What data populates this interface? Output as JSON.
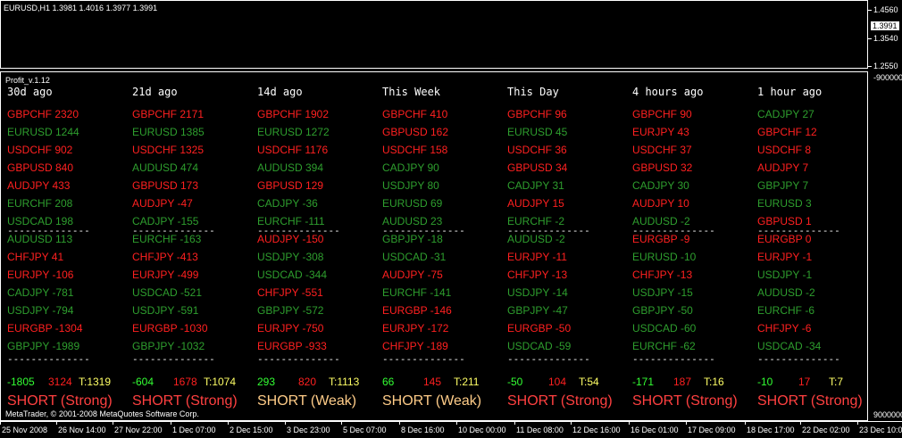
{
  "top_chart": {
    "title": "EURUSD,H1  1.3981 1.4016 1.3977 1.3991",
    "axis_labels": [
      "1.4560",
      "1.3540",
      "1.2550"
    ],
    "current_price": "1.3991"
  },
  "indicator": {
    "title": "Profit_v.1.12",
    "axis_labels": [
      "9000000",
      "-9000000"
    ],
    "copyright": "MetaTrader, © 2001-2008 MetaQuotes Software Corp.",
    "separator": "--------------",
    "colors": {
      "red": "#ff2020",
      "green": "#2e9e2e",
      "lime": "#33ff33",
      "yellow": "#ffff66",
      "peach": "#ffcc88"
    },
    "columns": [
      {
        "header": "30d ago",
        "top": [
          [
            "GBPCHF 2320",
            "red"
          ],
          [
            "EURUSD 1244",
            "green"
          ],
          [
            "USDCHF 902",
            "red"
          ],
          [
            "GBPUSD 840",
            "red"
          ],
          [
            "AUDJPY 433",
            "red"
          ],
          [
            "EURCHF 208",
            "green"
          ],
          [
            "USDCAD 198",
            "green"
          ]
        ],
        "bottom": [
          [
            "AUDUSD 113",
            "green"
          ],
          [
            "CHFJPY 41",
            "red"
          ],
          [
            "EURJPY -106",
            "red"
          ],
          [
            "CADJPY -781",
            "green"
          ],
          [
            "USDJPY -794",
            "green"
          ],
          [
            "EURGBP -1304",
            "red"
          ],
          [
            "GBPJPY -1989",
            "green"
          ]
        ],
        "totals": {
          "a": "-1805",
          "b": "3124",
          "t": "T:1319"
        },
        "signal": "SHORT (Strong)",
        "signal_color": "orange"
      },
      {
        "header": "21d ago",
        "top": [
          [
            "GBPCHF 2171",
            "red"
          ],
          [
            "EURUSD 1385",
            "green"
          ],
          [
            "USDCHF 1325",
            "red"
          ],
          [
            "AUDUSD 474",
            "green"
          ],
          [
            "GBPUSD 173",
            "red"
          ],
          [
            "AUDJPY -47",
            "red"
          ],
          [
            "CADJPY -155",
            "green"
          ]
        ],
        "bottom": [
          [
            "EURCHF -163",
            "green"
          ],
          [
            "CHFJPY -413",
            "red"
          ],
          [
            "EURJPY -499",
            "red"
          ],
          [
            "USDCAD -521",
            "green"
          ],
          [
            "USDJPY -591",
            "green"
          ],
          [
            "EURGBP -1030",
            "red"
          ],
          [
            "GBPJPY -1032",
            "green"
          ]
        ],
        "totals": {
          "a": "-604",
          "b": "1678",
          "t": "T:1074"
        },
        "signal": "SHORT (Strong)",
        "signal_color": "orange"
      },
      {
        "header": "14d ago",
        "top": [
          [
            "GBPCHF 1902",
            "red"
          ],
          [
            "EURUSD 1272",
            "green"
          ],
          [
            "USDCHF 1176",
            "red"
          ],
          [
            "AUDUSD 394",
            "green"
          ],
          [
            "GBPUSD 129",
            "red"
          ],
          [
            "CADJPY -36",
            "green"
          ],
          [
            "EURCHF -111",
            "green"
          ]
        ],
        "bottom": [
          [
            "AUDJPY -150",
            "red"
          ],
          [
            "USDJPY -308",
            "green"
          ],
          [
            "USDCAD -344",
            "green"
          ],
          [
            "CHFJPY -551",
            "red"
          ],
          [
            "GBPJPY -572",
            "green"
          ],
          [
            "EURJPY -750",
            "red"
          ],
          [
            "EURGBP -933",
            "red"
          ]
        ],
        "totals": {
          "a": "293",
          "b": "820",
          "t": "T:1113"
        },
        "signal": "SHORT (Weak)",
        "signal_color": "peach"
      },
      {
        "header": "This Week",
        "top": [
          [
            "GBPCHF 410",
            "red"
          ],
          [
            "GBPUSD 162",
            "red"
          ],
          [
            "USDCHF 158",
            "red"
          ],
          [
            "CADJPY 90",
            "green"
          ],
          [
            "USDJPY 80",
            "green"
          ],
          [
            "EURUSD 69",
            "green"
          ],
          [
            "AUDUSD 23",
            "green"
          ]
        ],
        "bottom": [
          [
            "GBPJPY -18",
            "green"
          ],
          [
            "USDCAD -31",
            "green"
          ],
          [
            "AUDJPY -75",
            "red"
          ],
          [
            "EURCHF -141",
            "green"
          ],
          [
            "EURGBP -146",
            "red"
          ],
          [
            "EURJPY -172",
            "red"
          ],
          [
            "CHFJPY -189",
            "red"
          ]
        ],
        "totals": {
          "a": "66",
          "b": "145",
          "t": "T:211"
        },
        "signal": "SHORT (Weak)",
        "signal_color": "peach"
      },
      {
        "header": "This Day",
        "top": [
          [
            "GBPCHF 96",
            "red"
          ],
          [
            "EURUSD 45",
            "green"
          ],
          [
            "USDCHF 36",
            "red"
          ],
          [
            "GBPUSD 34",
            "red"
          ],
          [
            "CADJPY 31",
            "green"
          ],
          [
            "AUDJPY 15",
            "red"
          ],
          [
            "EURCHF -2",
            "green"
          ]
        ],
        "bottom": [
          [
            "AUDUSD -2",
            "green"
          ],
          [
            "EURJPY -11",
            "red"
          ],
          [
            "CHFJPY -13",
            "red"
          ],
          [
            "USDJPY -14",
            "green"
          ],
          [
            "GBPJPY -47",
            "green"
          ],
          [
            "EURGBP -50",
            "red"
          ],
          [
            "USDCAD -59",
            "green"
          ]
        ],
        "totals": {
          "a": "-50",
          "b": "104",
          "t": "T:54"
        },
        "signal": "SHORT (Strong)",
        "signal_color": "orange"
      },
      {
        "header": "4 hours ago",
        "top": [
          [
            "GBPCHF 90",
            "red"
          ],
          [
            "EURJPY 43",
            "red"
          ],
          [
            "USDCHF 37",
            "red"
          ],
          [
            "GBPUSD 32",
            "red"
          ],
          [
            "CADJPY 30",
            "green"
          ],
          [
            "AUDJPY 10",
            "red"
          ],
          [
            "AUDUSD -2",
            "green"
          ]
        ],
        "bottom": [
          [
            "EURGBP -9",
            "red"
          ],
          [
            "EURUSD -10",
            "green"
          ],
          [
            "CHFJPY -13",
            "red"
          ],
          [
            "USDJPY -15",
            "green"
          ],
          [
            "GBPJPY -50",
            "green"
          ],
          [
            "USDCAD -60",
            "green"
          ],
          [
            "EURCHF -62",
            "green"
          ]
        ],
        "totals": {
          "a": "-171",
          "b": "187",
          "t": "T:16"
        },
        "signal": "SHORT (Strong)",
        "signal_color": "orange"
      },
      {
        "header": "1 hour ago",
        "top": [
          [
            "CADJPY 27",
            "green"
          ],
          [
            "GBPCHF 12",
            "red"
          ],
          [
            "USDCHF 8",
            "red"
          ],
          [
            "AUDJPY 7",
            "red"
          ],
          [
            "GBPJPY 7",
            "green"
          ],
          [
            "EURUSD 3",
            "green"
          ],
          [
            "GBPUSD 1",
            "red"
          ]
        ],
        "bottom": [
          [
            "EURGBP 0",
            "red"
          ],
          [
            "EURJPY -1",
            "red"
          ],
          [
            "USDJPY -1",
            "green"
          ],
          [
            "AUDUSD -2",
            "green"
          ],
          [
            "EURCHF -6",
            "green"
          ],
          [
            "CHFJPY -6",
            "red"
          ],
          [
            "USDCAD -34",
            "green"
          ]
        ],
        "totals": {
          "a": "-10",
          "b": "17",
          "t": "T:7"
        },
        "signal": "SHORT (Strong)",
        "signal_color": "orange"
      }
    ]
  },
  "time_axis": [
    "25 Nov 2008",
    "26 Nov 14:00",
    "27 Nov 22:00",
    "1 Dec 07:00",
    "2 Dec 15:00",
    "3 Dec 23:00",
    "5 Dec 07:00",
    "8 Dec 16:00",
    "10 Dec 00:00",
    "11 Dec 08:00",
    "12 Dec 16:00",
    "16 Dec 01:00",
    "17 Dec 09:00",
    "18 Dec 17:00",
    "22 Dec 02:00",
    "23 Dec 10:00"
  ]
}
